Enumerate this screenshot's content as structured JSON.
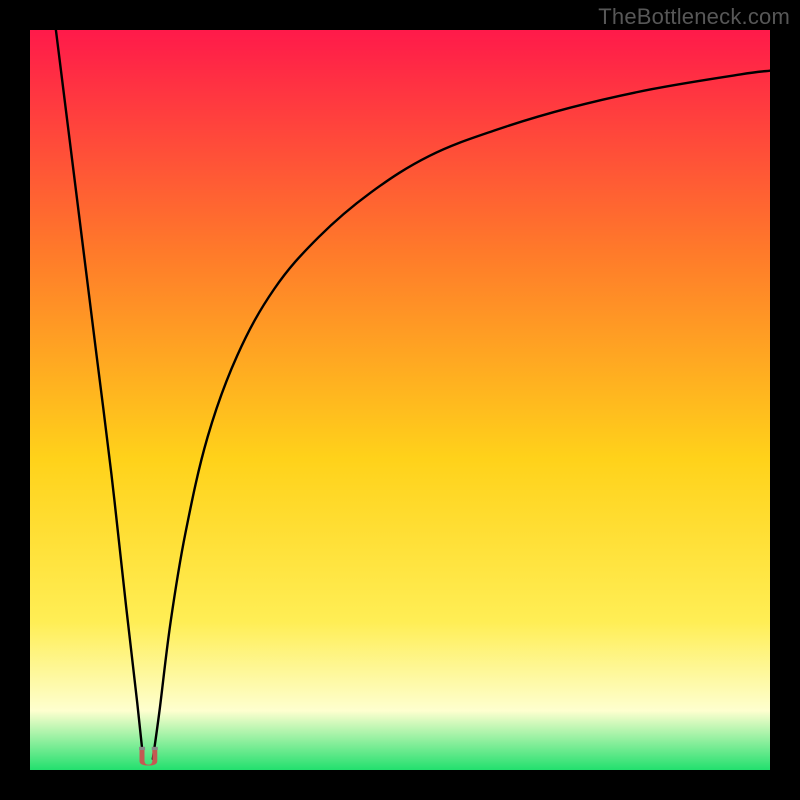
{
  "watermark": "TheBottleneck.com",
  "colors": {
    "top": "#ff1a4a",
    "mid1": "#ff7a2a",
    "mid2": "#ffd21a",
    "mid3": "#ffee55",
    "pale": "#feffcf",
    "green": "#22e06e",
    "curve": "#000000",
    "marker": "#c45a52",
    "markerCap": "#888888"
  },
  "chart_data": {
    "type": "line",
    "title": "",
    "xlabel": "",
    "ylabel": "",
    "xlim": [
      0,
      100
    ],
    "ylim": [
      0,
      100
    ],
    "optimal_x": 16,
    "left_branch": {
      "name": "left",
      "x": [
        3.5,
        5,
        7,
        9,
        11,
        13,
        14.5,
        15.3
      ],
      "y": [
        100,
        88,
        72,
        56,
        40,
        22,
        9,
        1.5
      ]
    },
    "right_branch": {
      "name": "right",
      "x": [
        16.6,
        17.5,
        19,
        21,
        24,
        28,
        33,
        39,
        46,
        54,
        63,
        73,
        84,
        96,
        100
      ],
      "y": [
        1.5,
        8,
        20,
        32,
        45,
        56,
        65,
        72,
        78,
        83,
        86.5,
        89.5,
        92,
        94,
        94.5
      ]
    },
    "marker": {
      "x": 16,
      "y": 0.6,
      "width": 2.4,
      "height": 2.4
    }
  }
}
